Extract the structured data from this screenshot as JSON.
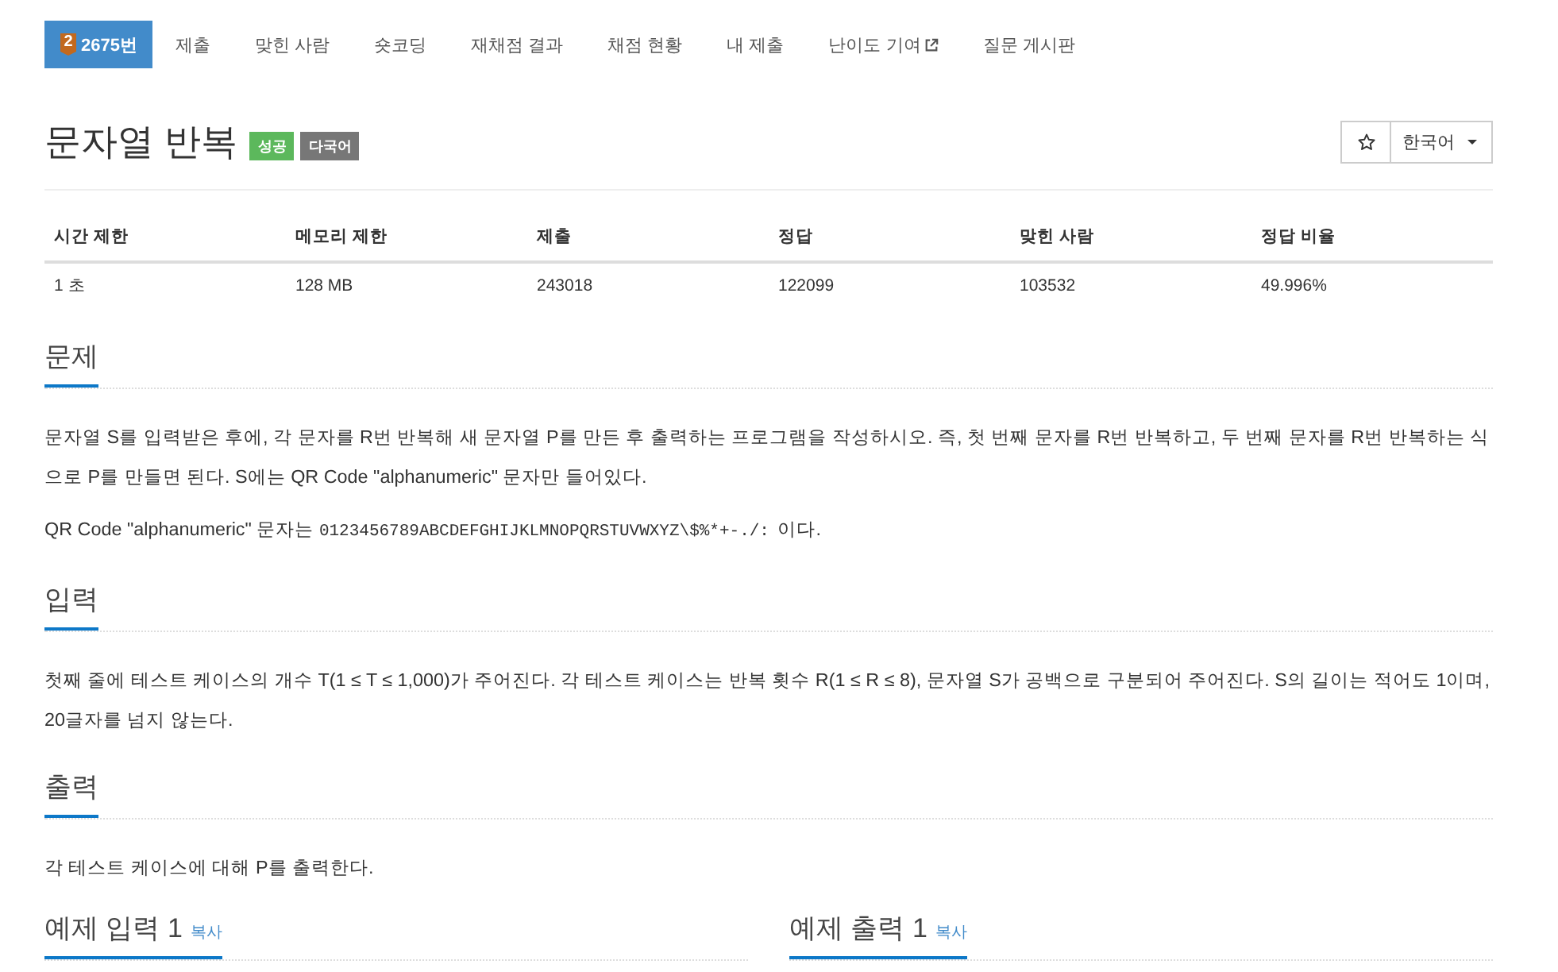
{
  "nav_tabs": [
    {
      "label": "2675번",
      "selected": true,
      "badge": "2",
      "external": false
    },
    {
      "label": "제출",
      "selected": false,
      "external": false
    },
    {
      "label": "맞힌 사람",
      "selected": false,
      "external": false
    },
    {
      "label": "숏코딩",
      "selected": false,
      "external": false
    },
    {
      "label": "재채점 결과",
      "selected": false,
      "external": false
    },
    {
      "label": "채점 현황",
      "selected": false,
      "external": false
    },
    {
      "label": "내 제출",
      "selected": false,
      "external": false
    },
    {
      "label": "난이도 기여",
      "selected": false,
      "external": true
    },
    {
      "label": "질문 게시판",
      "selected": false,
      "external": false
    }
  ],
  "problem": {
    "title": "문자열 반복",
    "labels": [
      {
        "text": "성공",
        "color": "#5cb85c"
      },
      {
        "text": "다국어",
        "color": "#777777"
      }
    ],
    "starred": false,
    "language": "한국어"
  },
  "info_table": {
    "columns": [
      "시간 제한",
      "메모리 제한",
      "제출",
      "정답",
      "맞힌 사람",
      "정답 비율"
    ],
    "rows": [
      [
        "1 초",
        "128 MB",
        "243018",
        "122099",
        "103532",
        "49.996%"
      ]
    ]
  },
  "sections": [
    {
      "heading": "문제",
      "paragraphs": [
        [
          {
            "kind": "text",
            "text": "문자열 S를 입력받은 후에, 각 문자를 R번 반복해 새 문자열 P를 만든 후 출력하는 프로그램을 작성하시오. 즉, 첫 번째 문자를 R번 반복하고, 두 번째 문자를 R번 반복하는 식으로 P를 만들면 된다. S에는 QR Code \"alphanumeric\" 문자만 들어있다."
          }
        ],
        [
          {
            "kind": "text",
            "text": "QR Code \"alphanumeric\" 문자는 "
          },
          {
            "kind": "code",
            "text": "0123456789ABCDEFGHIJKLMNOPQRSTUVWXYZ\\$%*+-./:"
          },
          {
            "kind": "text",
            "text": " 이다."
          }
        ]
      ]
    },
    {
      "heading": "입력",
      "paragraphs": [
        [
          {
            "kind": "text",
            "text": "첫째 줄에 테스트 케이스의 개수 T(1 ≤ T ≤ 1,000)가 주어진다. 각 테스트 케이스는 반복 횟수 R(1 ≤ R ≤ 8), 문자열 S가 공백으로 구분되어 주어진다. S의 길이는 적어도 1이며, 20글자를 넘지 않는다."
          }
        ]
      ]
    },
    {
      "heading": "출력",
      "paragraphs": [
        [
          {
            "kind": "text",
            "text": "각 테스트 케이스에 대해 P를 출력한다."
          }
        ]
      ]
    }
  ],
  "samples": [
    {
      "heading": "예제 입력 1",
      "action": "복사"
    },
    {
      "heading": "예제 출력 1",
      "action": "복사"
    }
  ]
}
